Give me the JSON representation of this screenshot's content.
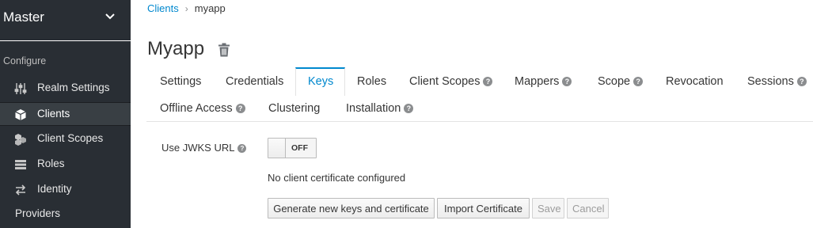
{
  "sidebar": {
    "realm": "Master",
    "section_label": "Configure",
    "items": [
      {
        "label": "Realm Settings",
        "icon": "sliders-icon"
      },
      {
        "label": "Clients",
        "icon": "cube-icon"
      },
      {
        "label": "Client Scopes",
        "icon": "cubes-icon"
      },
      {
        "label": "Roles",
        "icon": "list-icon"
      },
      {
        "label": "Identity",
        "icon": "exchange-icon"
      }
    ],
    "providers_label": "Providers"
  },
  "breadcrumb": {
    "parent": "Clients",
    "current": "myapp"
  },
  "page_title": "Myapp",
  "tabs": [
    {
      "label": "Settings"
    },
    {
      "label": "Credentials"
    },
    {
      "label": "Keys",
      "active": true
    },
    {
      "label": "Roles"
    },
    {
      "label": "Client Scopes",
      "help": true
    },
    {
      "label": "Mappers",
      "help": true
    },
    {
      "label": "Scope",
      "help": true
    },
    {
      "label": "Revocation"
    },
    {
      "label": "Sessions",
      "help": true
    },
    {
      "label": "Offline Access",
      "help": true
    },
    {
      "label": "Clustering"
    },
    {
      "label": "Installation",
      "help": true
    }
  ],
  "form": {
    "jwks_label": "Use JWKS URL",
    "jwks_state": "OFF",
    "status_text": "No client certificate configured"
  },
  "buttons": {
    "generate": "Generate new keys and certificate",
    "import": "Import Certificate",
    "save": "Save",
    "cancel": "Cancel"
  },
  "colors": {
    "accent": "#0088ce",
    "sidebar": "#292e34"
  }
}
